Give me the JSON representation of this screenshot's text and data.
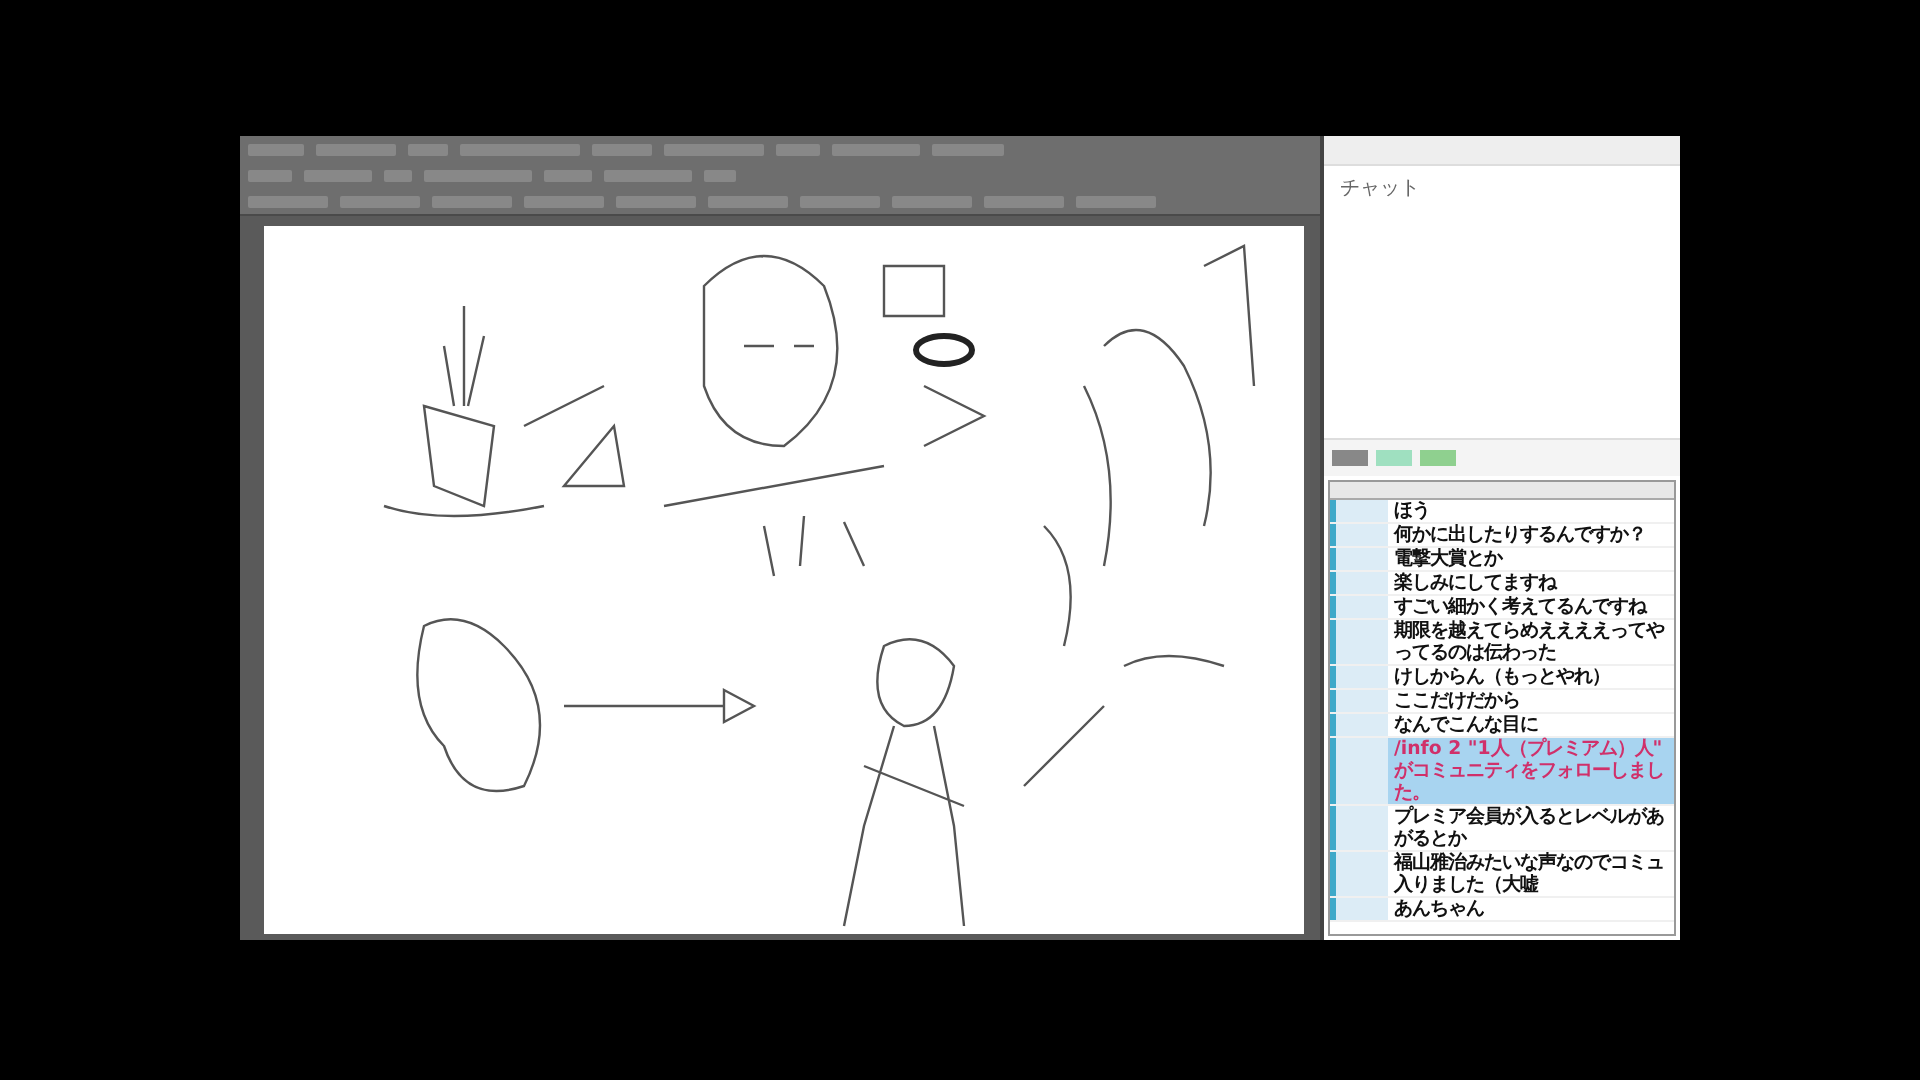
{
  "chat_panel": {
    "title": "チャット"
  },
  "comments": [
    {
      "kind": "comment",
      "text": "ほう"
    },
    {
      "kind": "comment",
      "text": "何かに出したりするんですか？"
    },
    {
      "kind": "comment",
      "text": "電撃大賞とか"
    },
    {
      "kind": "comment",
      "text": "楽しみにしてますね"
    },
    {
      "kind": "comment",
      "text": "すごい細かく考えてるんですね"
    },
    {
      "kind": "comment",
      "text": "期限を越えてらめええええってやってるのは伝わった"
    },
    {
      "kind": "comment",
      "text": "けしからん（もっとやれ）"
    },
    {
      "kind": "comment",
      "text": "ここだけだから"
    },
    {
      "kind": "comment",
      "text": "なんでこんな目に"
    },
    {
      "kind": "system",
      "text": "/info 2 \"1人（プレミアム）人\" がコミュニティをフォローしました。"
    },
    {
      "kind": "comment",
      "text": "プレミア会員が入るとレベルがあがるとか"
    },
    {
      "kind": "comment",
      "text": "福山雅治みたいな声なのでコミュ入りました（大嘘"
    },
    {
      "kind": "comment",
      "text": "あんちゃん"
    }
  ]
}
